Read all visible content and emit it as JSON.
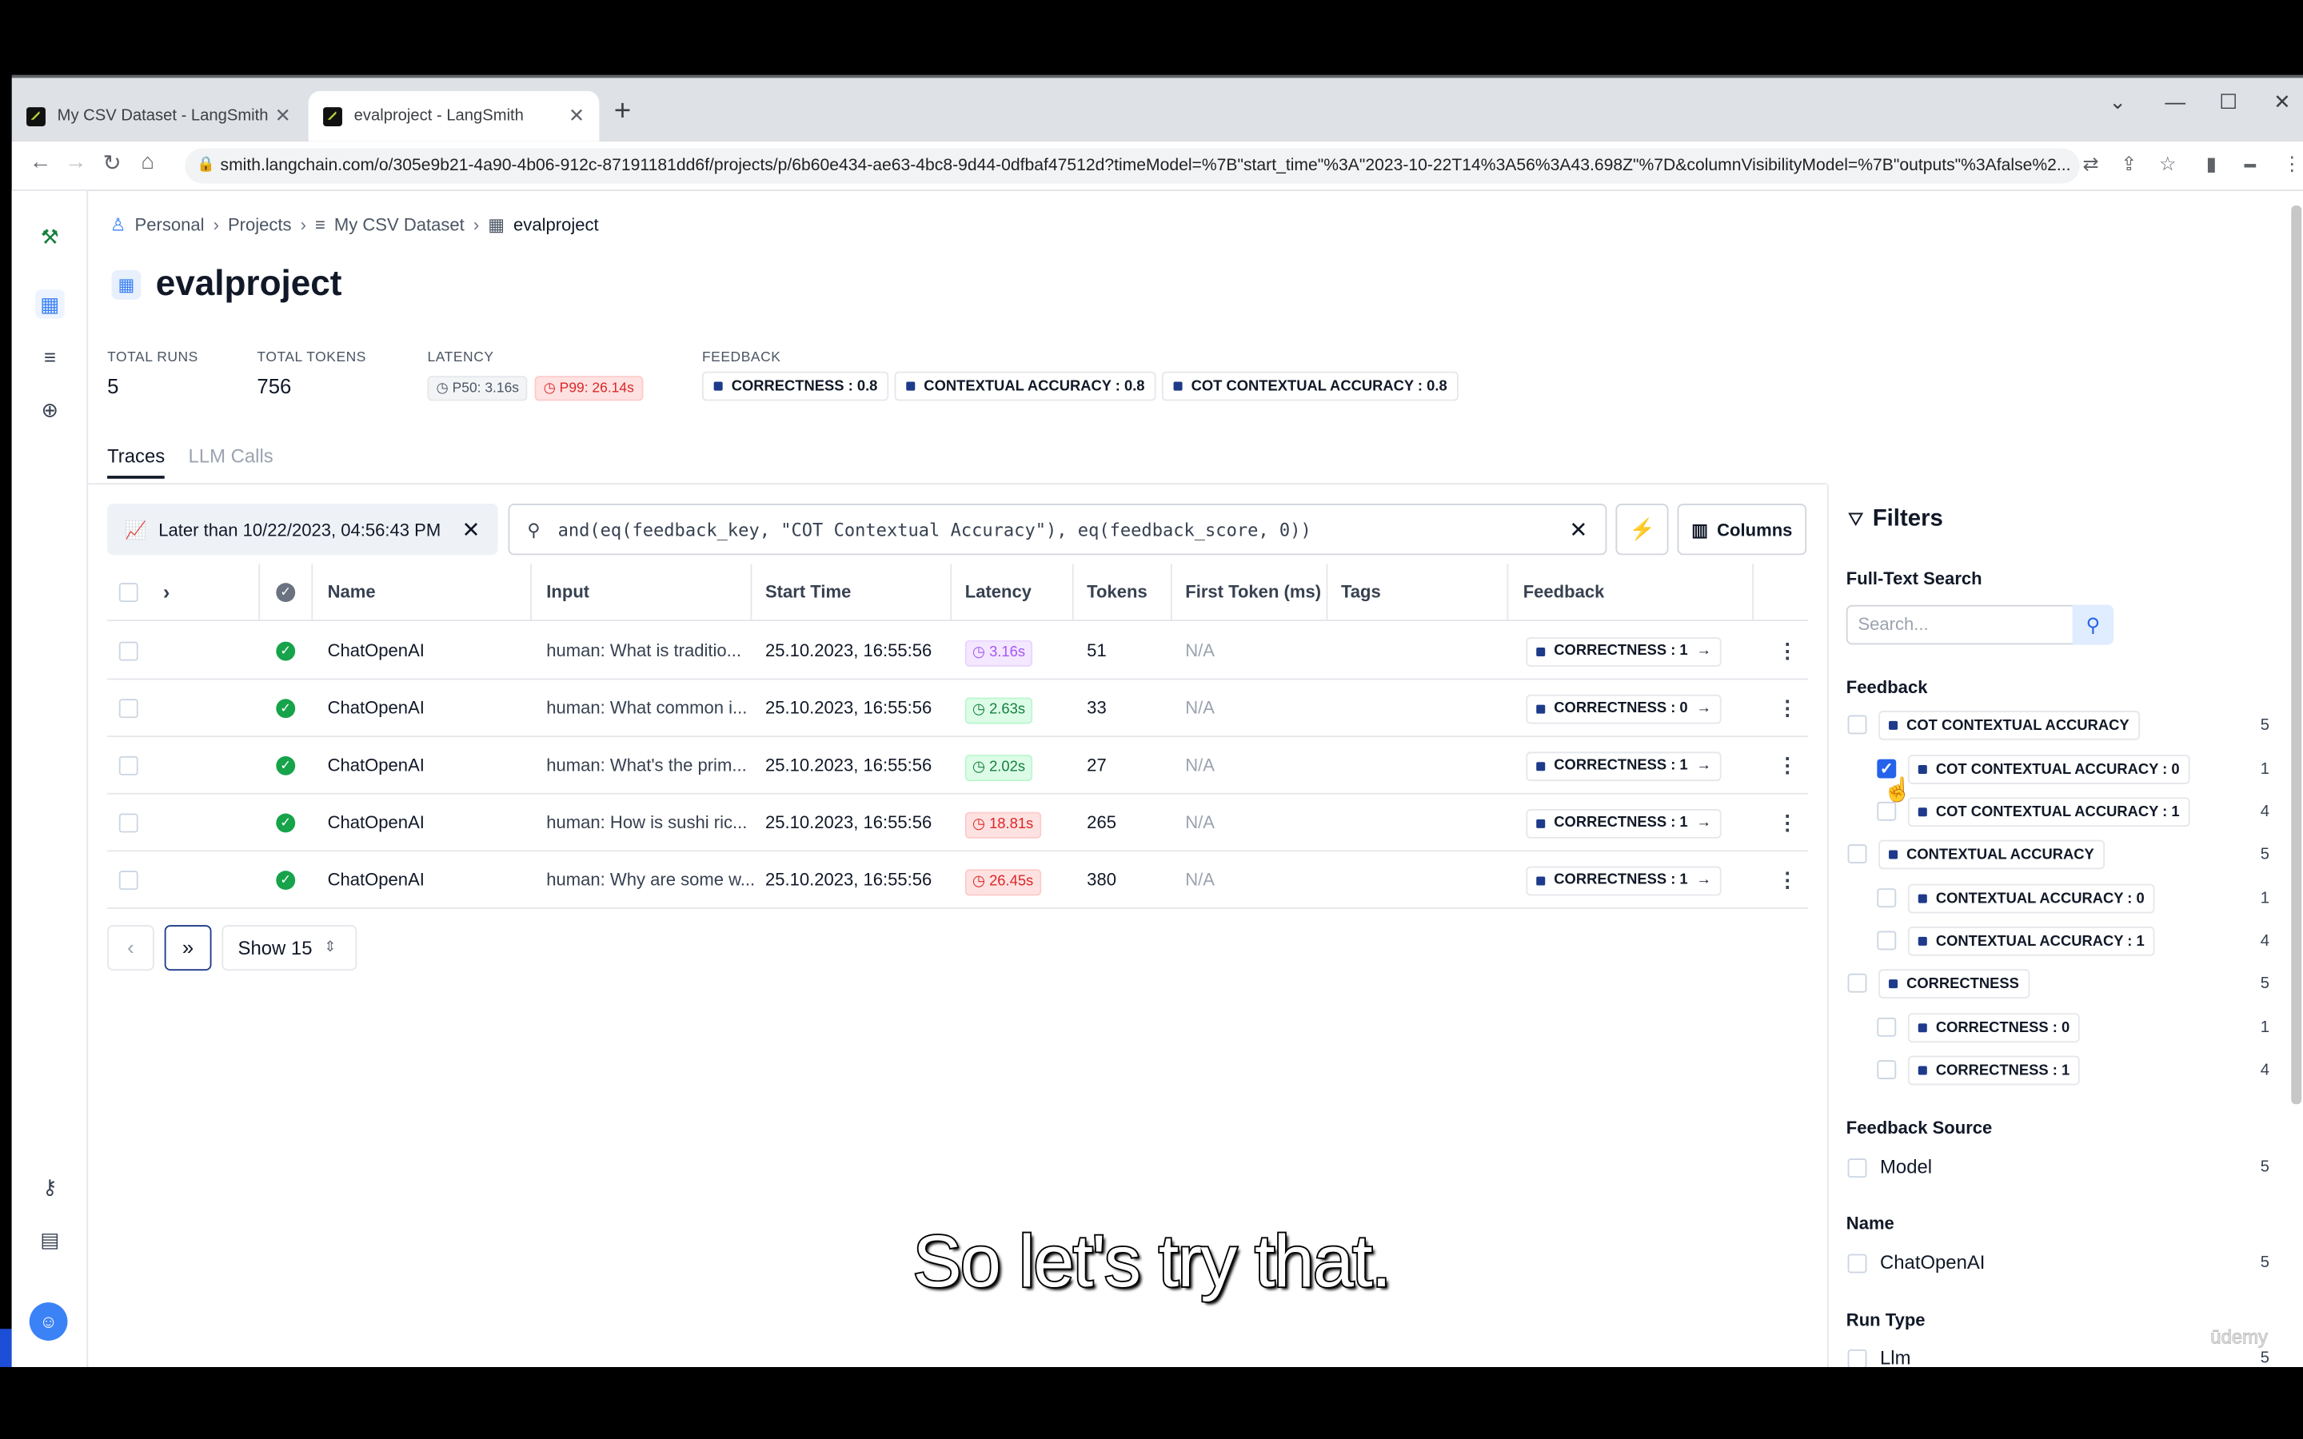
{
  "browser": {
    "tabs": [
      {
        "title": "My CSV Dataset - LangSmith"
      },
      {
        "title": "evalproject - LangSmith"
      }
    ],
    "url": "smith.langchain.com/o/305e9b21-4a90-4b06-912c-87191181dd6f/projects/p/6b60e434-ae63-4bc8-9d44-0dfbaf47512d?timeModel=%7B\"start_time\"%3A\"2023-10-22T14%3A56%3A43.698Z\"%7D&columnVisibilityModel=%7B\"outputs\"%3Afalse%2..."
  },
  "breadcrumb": [
    "Personal",
    "Projects",
    "My CSV Dataset",
    "evalproject"
  ],
  "project": {
    "title": "evalproject"
  },
  "stats": {
    "total_runs_label": "TOTAL RUNS",
    "total_runs": "5",
    "total_tokens_label": "TOTAL TOKENS",
    "total_tokens": "756",
    "latency_label": "LATENCY",
    "p50": "P50: 3.16s",
    "p99": "P99: 26.14s",
    "feedback_label": "FEEDBACK",
    "feedback": [
      "CORRECTNESS : 0.8",
      "CONTEXTUAL ACCURACY : 0.8",
      "COT CONTEXTUAL ACCURACY : 0.8"
    ]
  },
  "tabs": {
    "traces": "Traces",
    "llm_calls": "LLM Calls"
  },
  "toolbar": {
    "time_filter": "Later than 10/22/2023, 04:56:43 PM",
    "query": "and(eq(feedback_key, \"COT Contextual Accuracy\"), eq(feedback_score, 0))",
    "columns_label": "Columns"
  },
  "table": {
    "headers": {
      "name": "Name",
      "input": "Input",
      "start_time": "Start Time",
      "latency": "Latency",
      "tokens": "Tokens",
      "first_token": "First Token (ms)",
      "tags": "Tags",
      "feedback": "Feedback"
    },
    "rows": [
      {
        "name": "ChatOpenAI",
        "input": "human: What is traditio...",
        "start": "25.10.2023, 16:55:56",
        "latency": "3.16s",
        "latency_color": "purple",
        "tokens": "51",
        "first_token": "N/A",
        "feedback": "CORRECTNESS : 1"
      },
      {
        "name": "ChatOpenAI",
        "input": "human: What common i...",
        "start": "25.10.2023, 16:55:56",
        "latency": "2.63s",
        "latency_color": "green",
        "tokens": "33",
        "first_token": "N/A",
        "feedback": "CORRECTNESS : 0"
      },
      {
        "name": "ChatOpenAI",
        "input": "human: What's the prim...",
        "start": "25.10.2023, 16:55:56",
        "latency": "2.02s",
        "latency_color": "green",
        "tokens": "27",
        "first_token": "N/A",
        "feedback": "CORRECTNESS : 1"
      },
      {
        "name": "ChatOpenAI",
        "input": "human: How is sushi ric...",
        "start": "25.10.2023, 16:55:56",
        "latency": "18.81s",
        "latency_color": "red",
        "tokens": "265",
        "first_token": "N/A",
        "feedback": "CORRECTNESS : 1"
      },
      {
        "name": "ChatOpenAI",
        "input": "human: Why are some w...",
        "start": "25.10.2023, 16:55:56",
        "latency": "26.45s",
        "latency_color": "red",
        "tokens": "380",
        "first_token": "N/A",
        "feedback": "CORRECTNESS : 1"
      }
    ]
  },
  "pagination": {
    "show": "Show 15"
  },
  "filters": {
    "title": "Filters",
    "full_text_label": "Full-Text Search",
    "search_placeholder": "Search...",
    "feedback_label": "Feedback",
    "feedback_items": [
      {
        "label": "COT CONTEXTUAL ACCURACY",
        "count": "5",
        "checked": false
      },
      {
        "label": "COT CONTEXTUAL ACCURACY : 0",
        "count": "1",
        "checked": true
      },
      {
        "label": "COT CONTEXTUAL ACCURACY : 1",
        "count": "4",
        "checked": false
      },
      {
        "label": "CONTEXTUAL ACCURACY",
        "count": "5",
        "checked": false
      },
      {
        "label": "CONTEXTUAL ACCURACY : 0",
        "count": "1",
        "checked": false
      },
      {
        "label": "CONTEXTUAL ACCURACY : 1",
        "count": "4",
        "checked": false
      },
      {
        "label": "CORRECTNESS",
        "count": "5",
        "checked": false
      },
      {
        "label": "CORRECTNESS : 0",
        "count": "1",
        "checked": false
      },
      {
        "label": "CORRECTNESS : 1",
        "count": "4",
        "checked": false
      }
    ],
    "feedback_source_label": "Feedback Source",
    "feedback_source": {
      "label": "Model",
      "count": "5"
    },
    "name_label": "Name",
    "name": {
      "label": "ChatOpenAI",
      "count": "5"
    },
    "run_type_label": "Run Type",
    "run_type": {
      "label": "Llm",
      "count": "5"
    }
  },
  "subtitle": "So let's try that.",
  "watermark": "ūdemy"
}
